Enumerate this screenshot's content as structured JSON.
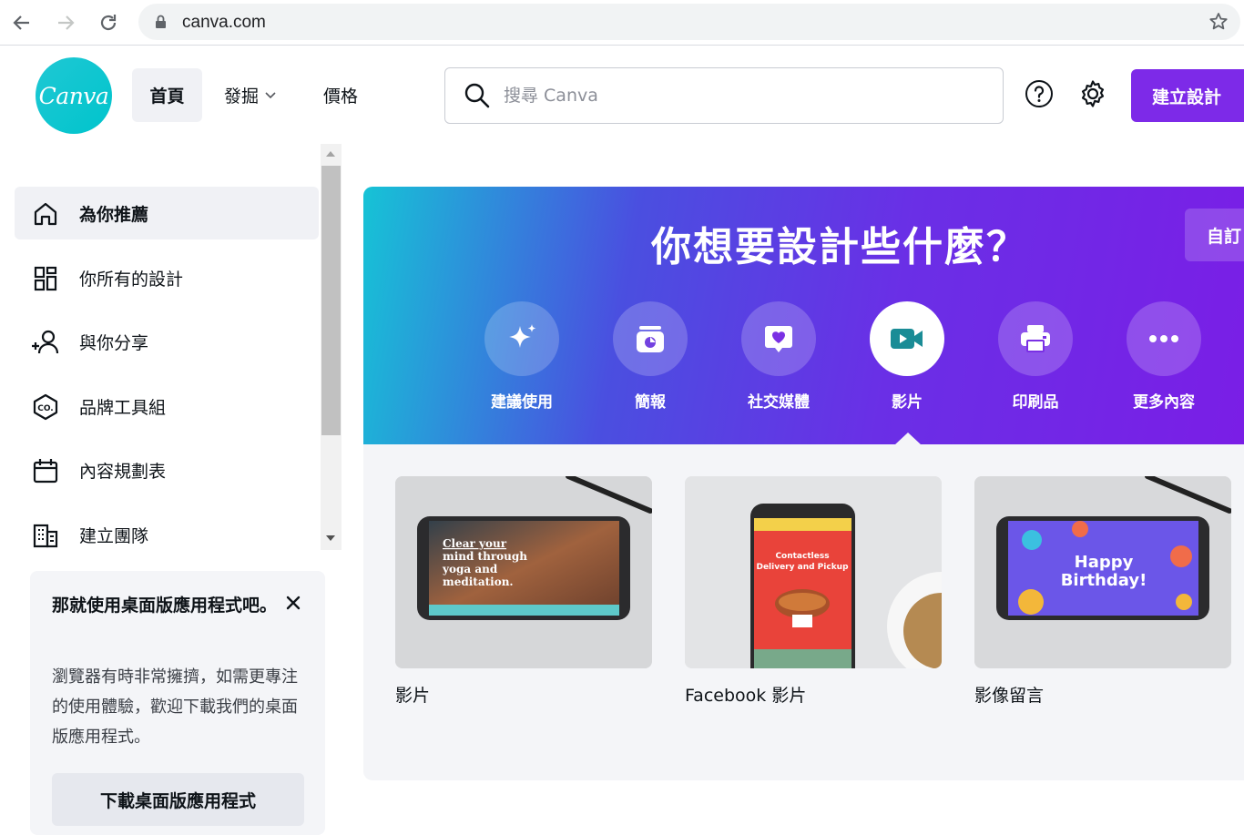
{
  "browser": {
    "url": "canva.com"
  },
  "header": {
    "logo_text": "Canva",
    "nav": [
      {
        "label": "首頁"
      },
      {
        "label": "發掘"
      },
      {
        "label": "價格"
      }
    ],
    "search_placeholder": "搜尋 Canva",
    "create_label": "建立設計"
  },
  "sidebar": {
    "items": [
      {
        "label": "為你推薦",
        "icon": "home-icon"
      },
      {
        "label": "你所有的設計",
        "icon": "grid-icon"
      },
      {
        "label": "與你分享",
        "icon": "shared-users-icon"
      },
      {
        "label": "品牌工具組",
        "icon": "brand-kit-icon"
      },
      {
        "label": "內容規劃表",
        "icon": "calendar-icon"
      },
      {
        "label": "建立團隊",
        "icon": "building-icon"
      }
    ]
  },
  "promo": {
    "title": "那就使用桌面版應用程式吧。",
    "body": "瀏覽器有時非常擁擠，如需更專注的使用體驗，歡迎下載我們的桌面版應用程式。",
    "button": "下載桌面版應用程式"
  },
  "hero": {
    "title": "你想要設計些什麼？",
    "custom_label": "自訂",
    "categories": [
      {
        "label": "建議使用",
        "icon": "sparkle-icon"
      },
      {
        "label": "簡報",
        "icon": "presentation-icon"
      },
      {
        "label": "社交媒體",
        "icon": "heart-chat-icon"
      },
      {
        "label": "影片",
        "icon": "video-camera-icon",
        "active": true
      },
      {
        "label": "印刷品",
        "icon": "printer-icon"
      },
      {
        "label": "更多內容",
        "icon": "more-dots-icon"
      }
    ]
  },
  "cards": [
    {
      "title": "影片",
      "thumb_text": "Clear your mind through yoga and meditation."
    },
    {
      "title": "Facebook 影片",
      "thumb_text": "Contactless Delivery and Pickup"
    },
    {
      "title": "影像留言",
      "thumb_text": "Happy Birthday!"
    }
  ],
  "colors": {
    "brand_purple": "#7d2ae8",
    "brand_teal": "#00c4cc"
  }
}
